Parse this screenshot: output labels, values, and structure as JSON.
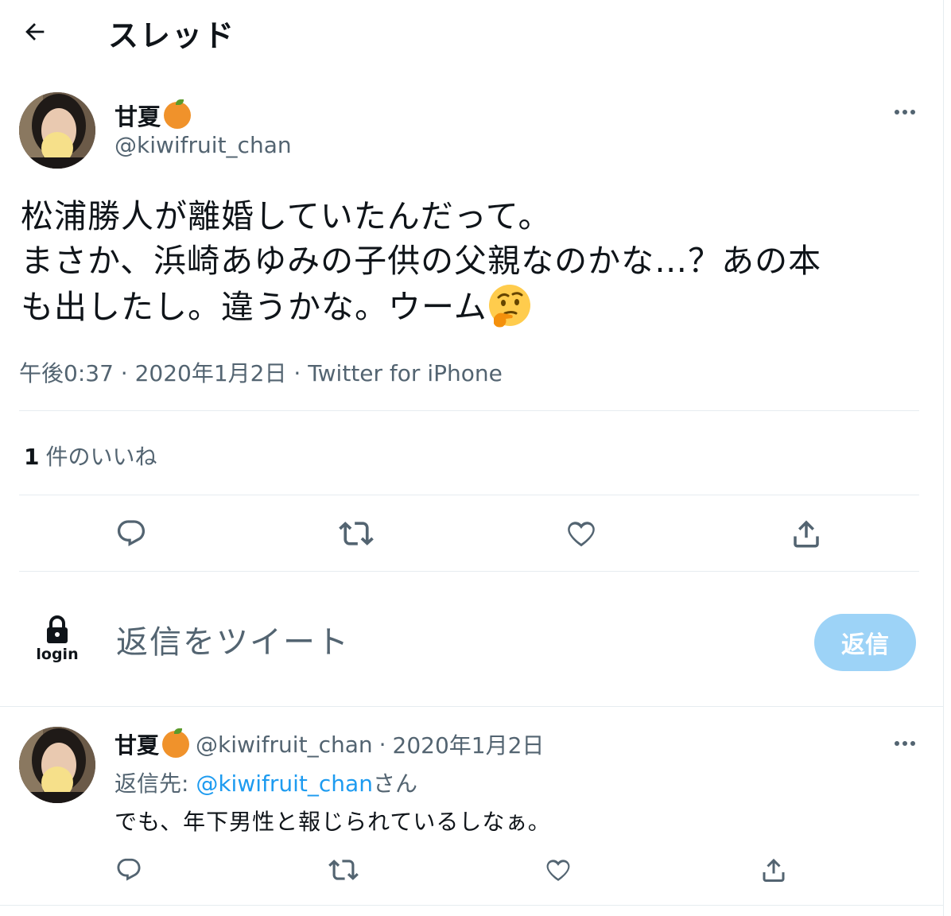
{
  "header": {
    "title": "スレッド"
  },
  "tweet": {
    "author_name": "甘夏",
    "handle": "@kiwifruit_chan",
    "text_line1": "松浦勝人が離婚していたんだって。",
    "text_line2": "まさか、浜崎あゆみの子供の父親なのかな…？あの本",
    "text_line3": "も出したし。違うかな。ウーム",
    "time": "午後0:37",
    "date": "2020年1月2日",
    "source": "Twitter for iPhone",
    "likes_count": "1",
    "likes_label": "件のいいね"
  },
  "composer": {
    "login_label": "login",
    "placeholder": "返信をツイート",
    "reply_button": "返信"
  },
  "reply": {
    "author_name": "甘夏",
    "handle": "@kiwifruit_chan",
    "date": "2020年1月2日",
    "replying_prefix": "返信先:",
    "replying_handle": "@kiwifruit_chan",
    "replying_suffix": "さん",
    "text": "でも、年下男性と報じられているしなぁ。"
  },
  "colors": {
    "accent": "#1d9bf0",
    "reply_button_disabled": "#9dd3f7",
    "secondary_text": "#536471",
    "border": "#e6ecf0"
  },
  "icons": [
    "back-arrow-icon",
    "orange-emoji-icon",
    "more-icon",
    "thinking-face-emoji-icon",
    "reply-icon",
    "retweet-icon",
    "like-icon",
    "share-icon",
    "lock-icon"
  ]
}
